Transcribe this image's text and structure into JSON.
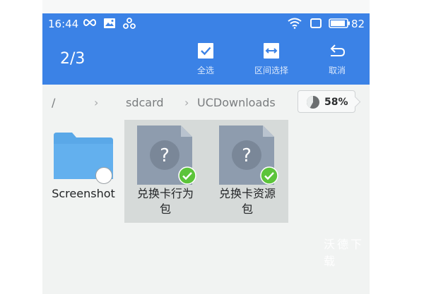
{
  "status": {
    "time": "16:44",
    "battery": "82",
    "icons": [
      "infinity-icon",
      "image-notification-icon",
      "link-icon",
      "wifi-icon",
      "screen-icon",
      "battery-icon"
    ]
  },
  "header": {
    "selection_count": "2/3",
    "actions": [
      {
        "label": "全选",
        "icon": "checkbox-icon"
      },
      {
        "label": "区间选择",
        "icon": "range-select-icon"
      },
      {
        "label": "取消",
        "icon": "undo-icon"
      }
    ]
  },
  "path": {
    "root": "/",
    "crumbs": [
      "sdcard",
      "UCDownloads"
    ]
  },
  "storage": {
    "usage": "58%",
    "fraction": 0.58
  },
  "files": [
    {
      "name": "Screenshot",
      "type": "folder",
      "selected": false
    },
    {
      "name": "兑换卡行为包",
      "line1": "兑换卡行为",
      "line2": "包",
      "type": "unknown-file",
      "selected": true
    },
    {
      "name": "兑换卡资源包",
      "line1": "兑换卡资源",
      "line2": "包",
      "type": "unknown-file",
      "selected": true
    }
  ],
  "watermark": "沃德下载",
  "colors": {
    "header": "#3b82e6",
    "background": "#f1f3f2",
    "selected_tile": "#d6dad9",
    "check": "#5cc43a",
    "folder": "#5aa8e8",
    "file_icon": "#8e9cae"
  }
}
